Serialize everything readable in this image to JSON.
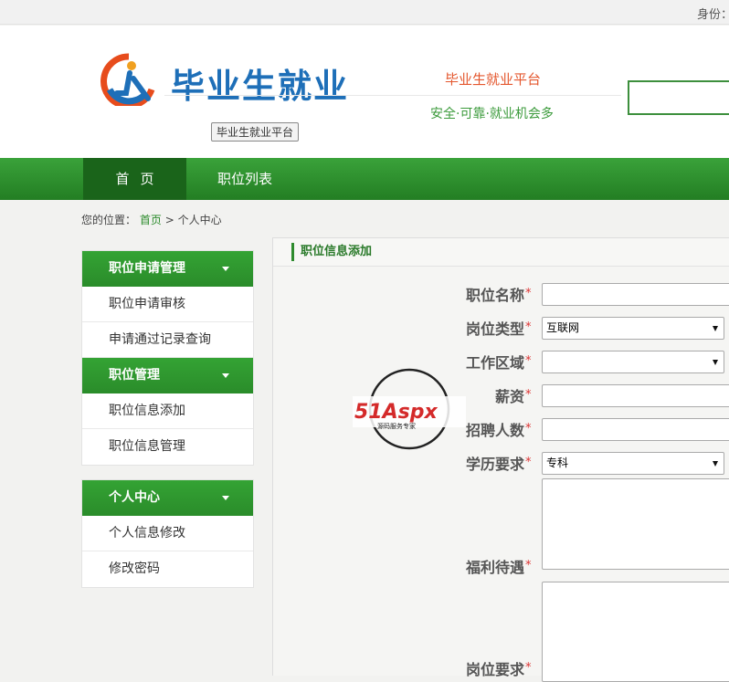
{
  "topbar": {
    "identity_label": "身份："
  },
  "header": {
    "site_title": "毕业生就业",
    "site_badge": "毕业生就业平台",
    "platform_name": "毕业生就业平台",
    "slogan": "安全·可靠·就业机会多"
  },
  "nav": {
    "tabs": [
      {
        "label": "首页"
      },
      {
        "label": "职位列表"
      }
    ]
  },
  "breadcrumb": {
    "prefix": "您的位置：",
    "home": "首页",
    "sep": ">",
    "current": "个人中心"
  },
  "sidebar": {
    "groups": [
      {
        "title": "职位申请管理",
        "items": [
          {
            "label": "职位申请审核"
          },
          {
            "label": "申请通过记录查询"
          }
        ]
      },
      {
        "title": "职位管理",
        "items": [
          {
            "label": "职位信息添加"
          },
          {
            "label": "职位信息管理"
          }
        ]
      },
      {
        "title": "个人中心",
        "items": [
          {
            "label": "个人信息修改"
          },
          {
            "label": "修改密码"
          }
        ]
      }
    ]
  },
  "form": {
    "title": "职位信息添加",
    "required_mark": "*",
    "fields": {
      "job_name": {
        "label": "职位名称",
        "value": ""
      },
      "job_type": {
        "label": "岗位类型",
        "value": "互联网"
      },
      "work_area": {
        "label": "工作区域",
        "value": ""
      },
      "salary": {
        "label": "薪资",
        "value": ""
      },
      "headcount": {
        "label": "招聘人数",
        "value": ""
      },
      "education": {
        "label": "学历要求",
        "value": "专科"
      },
      "benefits": {
        "label": "福利待遇",
        "value": ""
      },
      "requirements": {
        "label": "岗位要求",
        "value": ""
      }
    }
  },
  "watermark": {
    "brand": "51Aspx",
    "tagline": "源码服务专家"
  }
}
